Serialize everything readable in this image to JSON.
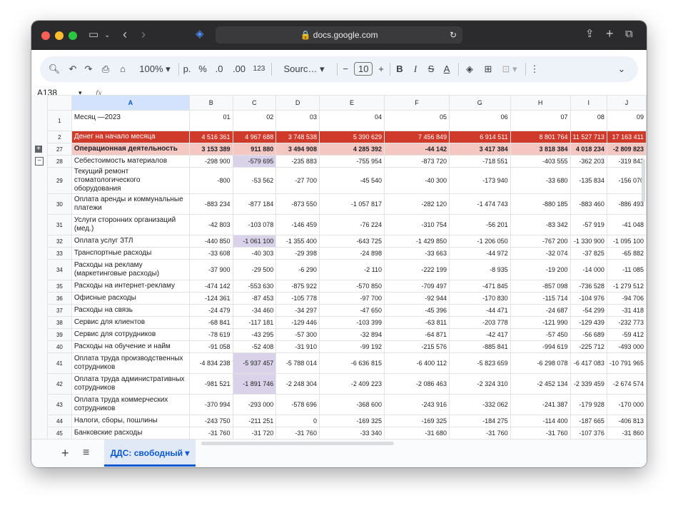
{
  "browser": {
    "url": "docs.google.com",
    "colors": {
      "close": "#fe5f57",
      "minimize": "#febc2e",
      "zoom": "#28c840"
    }
  },
  "toolbar": {
    "zoom": "100%",
    "format_p": "р.",
    "format_pct": "%",
    "dec_less": ".0",
    "dec_more": ".00",
    "format_123": "123",
    "font": "Sourc…",
    "font_size": "10",
    "minus": "−",
    "plus": "+",
    "bold": "B",
    "italic": "I",
    "strike": "S",
    "text_color": "A"
  },
  "formula_bar": {
    "cell_ref": "A138",
    "fx": "fx"
  },
  "columns": [
    "A",
    "B",
    "C",
    "D",
    "E",
    "F",
    "G",
    "H",
    "I",
    "J"
  ],
  "rows": [
    {
      "num": "1",
      "name": "Месяц —2023",
      "vals": [
        "01",
        "02",
        "03",
        "04",
        "05",
        "06",
        "07",
        "08",
        "09"
      ],
      "style": "month"
    },
    {
      "num": "2",
      "name": "Денег на начало месяца",
      "vals": [
        "4 516 361",
        "4 967 688",
        "3 748 538",
        "5 390 629",
        "7 456 849",
        "6 914 511",
        "8 801 764",
        "11 527 713",
        "17 163 411"
      ],
      "style": "red"
    },
    {
      "num": "27",
      "name": "Операционная деятельность",
      "vals": [
        "3 153 389",
        "911 880",
        "3 494 908",
        "4 285 392",
        "-44 142",
        "3 417 384",
        "3 818 384",
        "4 018 234",
        "-2 809 823"
      ],
      "style": "pink"
    },
    {
      "num": "28",
      "name": "Себестоимость материалов",
      "vals": [
        "-298 900",
        "-579 695",
        "-235 883",
        "-755 954",
        "-873 720",
        "-718 551",
        "-403 555",
        "-362 203",
        "-319 843"
      ],
      "hl": 1
    },
    {
      "num": "29",
      "name": "Текущий ремонт стоматологического оборудования",
      "vals": [
        "-800",
        "-53 562",
        "-27 700",
        "-45 540",
        "-40 300",
        "-173 940",
        "-33 680",
        "-135 834",
        "-156 070"
      ]
    },
    {
      "num": "30",
      "name": "Оплата аренды и коммунальные платежи",
      "vals": [
        "-883 234",
        "-877 184",
        "-873 550",
        "-1 057 817",
        "-282 120",
        "-1 474 743",
        "-880 185",
        "-883 460",
        "-886 493"
      ]
    },
    {
      "num": "31",
      "name": "Услуги сторонних организаций (мед.)",
      "vals": [
        "-42 803",
        "-103 078",
        "-146 459",
        "-76 224",
        "-310 754",
        "-56 201",
        "-83 342",
        "-57 919",
        "-41 048"
      ]
    },
    {
      "num": "32",
      "name": "Оплата услуг ЗТЛ",
      "vals": [
        "-440 850",
        "-1 061 100",
        "-1 355 400",
        "-643 725",
        "-1 429 850",
        "-1 206 050",
        "-767 200",
        "-1 330 900",
        "-1 095 100"
      ],
      "hl": 1
    },
    {
      "num": "33",
      "name": "Транспортные расходы",
      "vals": [
        "-33 608",
        "-40 303",
        "-29 398",
        "-24 898",
        "-33 663",
        "-44 972",
        "-32 074",
        "-37 825",
        "-65 882"
      ]
    },
    {
      "num": "34",
      "name": "Расходы на рекламу (маркетинговые расходы)",
      "vals": [
        "-37 900",
        "-29 500",
        "-6 290",
        "-2 110",
        "-222 199",
        "-8 935",
        "-19 200",
        "-14 000",
        "-11 085"
      ]
    },
    {
      "num": "35",
      "name": "Расходы на интернет-рекламу",
      "vals": [
        "-474 142",
        "-553 630",
        "-875 922",
        "-570 850",
        "-709 497",
        "-471 845",
        "-857 098",
        "-736 528",
        "-1 279 512"
      ]
    },
    {
      "num": "36",
      "name": "Офисные расходы",
      "vals": [
        "-124 361",
        "-87 453",
        "-105 778",
        "-97 700",
        "-92 944",
        "-170 830",
        "-115 714",
        "-104 976",
        "-94 706"
      ]
    },
    {
      "num": "37",
      "name": "Расходы на связь",
      "vals": [
        "-24 479",
        "-34 460",
        "-34 297",
        "-47 650",
        "-45 396",
        "-44 471",
        "-24 687",
        "-54 299",
        "-31 418"
      ]
    },
    {
      "num": "38",
      "name": "Сервис для клиентов",
      "vals": [
        "-68 841",
        "-117 181",
        "-129 446",
        "-103 399",
        "-63 811",
        "-203 778",
        "-121 990",
        "-129 439",
        "-232 773"
      ]
    },
    {
      "num": "39",
      "name": "Сервис для сотрудников",
      "vals": [
        "-78 619",
        "-43 295",
        "-57 300",
        "-32 894",
        "-64 871",
        "-42 417",
        "-57 450",
        "-56 689",
        "-59 412"
      ]
    },
    {
      "num": "40",
      "name": "Расходы на обучение и найм",
      "vals": [
        "-91 058",
        "-52 408",
        "-31 910",
        "-99 192",
        "-215 576",
        "-885 841",
        "-994 619",
        "-225 712",
        "-493 000"
      ]
    },
    {
      "num": "41",
      "name": "Оплата труда производственных сотрудников",
      "vals": [
        "-4 834 238",
        "-5 937 457",
        "-5 788 014",
        "-6 636 815",
        "-6 400 112",
        "-5 823 659",
        "-6 298 078",
        "-6 417 083",
        "-10 791 965"
      ],
      "hl": 1
    },
    {
      "num": "42",
      "name": "Оплата труда административных сотрудников",
      "vals": [
        "-981 521",
        "-1 891 746",
        "-2 248 304",
        "-2 409 223",
        "-2 086 463",
        "-2 324 310",
        "-2 452 134",
        "-2 339 459",
        "-2 674 574"
      ],
      "hl": 1
    },
    {
      "num": "43",
      "name": "Оплата труда коммерческих сотрудников",
      "vals": [
        "-370 994",
        "-293 000",
        "-578 696",
        "-368 600",
        "-243 916",
        "-332 062",
        "-241 387",
        "-179 928",
        "-170 000"
      ]
    },
    {
      "num": "44",
      "name": "Налоги, сборы, пошлины",
      "vals": [
        "-243 750",
        "-211 251",
        "0",
        "-169 325",
        "-169 325",
        "-184 275",
        "-114 400",
        "-187 665",
        "-406 813"
      ]
    },
    {
      "num": "45",
      "name": "Банковские расходы",
      "vals": [
        "-31 760",
        "-31 720",
        "-31 760",
        "-33 340",
        "-31 680",
        "-31 760",
        "-31 760",
        "-107 376",
        "-31 860"
      ]
    }
  ],
  "sheets": {
    "add": "+",
    "menu": "≡",
    "active": "ДДС: свободный"
  }
}
